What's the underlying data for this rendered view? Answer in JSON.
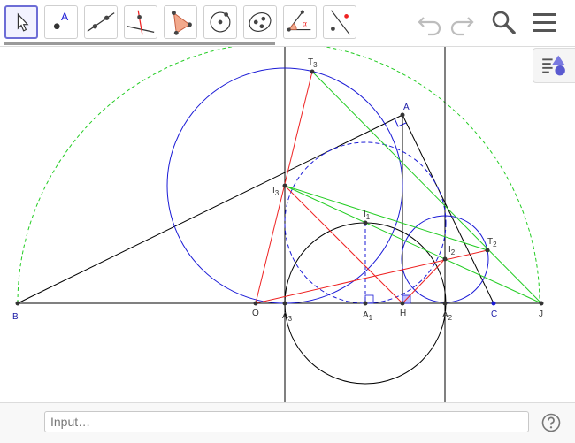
{
  "toolbar": {
    "tools": [
      {
        "icon": "move-arrow-icon"
      },
      {
        "icon": "point-icon",
        "label": "A"
      },
      {
        "icon": "line-icon"
      },
      {
        "icon": "perpendicular-line-icon"
      },
      {
        "icon": "polygon-icon"
      },
      {
        "icon": "circle-center-point-icon"
      },
      {
        "icon": "conic-through-points-icon"
      },
      {
        "icon": "angle-icon",
        "label": "α"
      },
      {
        "icon": "reflect-icon"
      }
    ],
    "undo_icon": "undo-icon",
    "redo_icon": "redo-icon",
    "search_icon": "search-icon",
    "menu_icon": "menu-icon"
  },
  "construction": {
    "points": {
      "B": "B",
      "O": "O",
      "A3": "A",
      "A3_sub": "3",
      "A1": "A",
      "A1_sub": "1",
      "H": "H",
      "A2": "A",
      "A2_sub": "2",
      "C": "C",
      "J": "J",
      "A": "A",
      "T3": "T",
      "T3_sub": "3",
      "I3": "I",
      "I3_sub": "3",
      "I1": "I",
      "I1_sub": "1",
      "I2": "I",
      "I2_sub": "2",
      "T2": "T",
      "T2_sub": "2"
    }
  },
  "input_bar": {
    "placeholder": "Input…",
    "help_icon": "help-icon"
  },
  "colors": {
    "blue": "#1a1ad6",
    "red": "#ee2222",
    "green": "#22cc22",
    "black": "#000000",
    "accent": "#6d6dd6"
  }
}
